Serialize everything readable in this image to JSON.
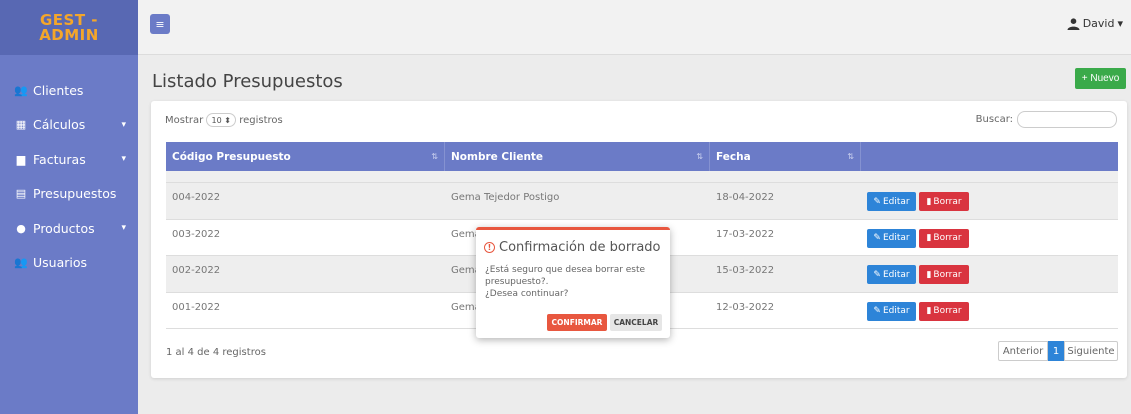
{
  "brand": {
    "line1": "GEST -",
    "line2": "ADMIN"
  },
  "sidebar": {
    "items": [
      {
        "label": "Clientes",
        "icon": "users-icon",
        "glyph": "👥",
        "caret": ""
      },
      {
        "label": "Cálculos",
        "icon": "calculator-icon",
        "glyph": "▦",
        "caret": "▾"
      },
      {
        "label": "Facturas",
        "icon": "file-icon",
        "glyph": "▆",
        "caret": "▾"
      },
      {
        "label": "Presupuestos",
        "icon": "document-icon",
        "glyph": "▤",
        "caret": ""
      },
      {
        "label": "Productos",
        "icon": "product-icon",
        "glyph": "●",
        "caret": "▾"
      },
      {
        "label": "Usuarios",
        "icon": "users-cog-icon",
        "glyph": "👥",
        "caret": ""
      }
    ]
  },
  "topbar": {
    "menu_glyph": "≡",
    "user_name": "David",
    "user_caret": "▾"
  },
  "page": {
    "title": "Listado Presupuestos",
    "new_label": "+ Nuevo"
  },
  "table_controls": {
    "show_label": "Mostrar",
    "length_value": "10 ⬍",
    "records_label": "registros",
    "search_label": "Buscar:"
  },
  "table": {
    "headers": [
      "Código Presupuesto",
      "Nombre Cliente",
      "Fecha",
      ""
    ],
    "sort_glyph": "⇅",
    "rows": [
      {
        "code": "004-2022",
        "client": "Gema Tejedor Postigo",
        "date": "18-04-2022"
      },
      {
        "code": "003-2022",
        "client": "Gema",
        "date": "17-03-2022"
      },
      {
        "code": "002-2022",
        "client": "Gema",
        "date": "15-03-2022"
      },
      {
        "code": "001-2022",
        "client": "Gema",
        "date": "12-03-2022"
      }
    ],
    "edit_label": "Editar",
    "delete_label": "Borrar"
  },
  "footer": {
    "info": "1 al 4 de 4 registros",
    "prev": "Anterior",
    "current": "1",
    "next": "Siguiente"
  },
  "dialog": {
    "title": "Confirmación de borrado",
    "warn_glyph": "!",
    "line1": "¿Está seguro que desea borrar este",
    "line2": "presupuesto?.",
    "line3": "¿Desea continuar?",
    "confirm": "CONFIRMAR",
    "cancel": "CANCELAR"
  }
}
